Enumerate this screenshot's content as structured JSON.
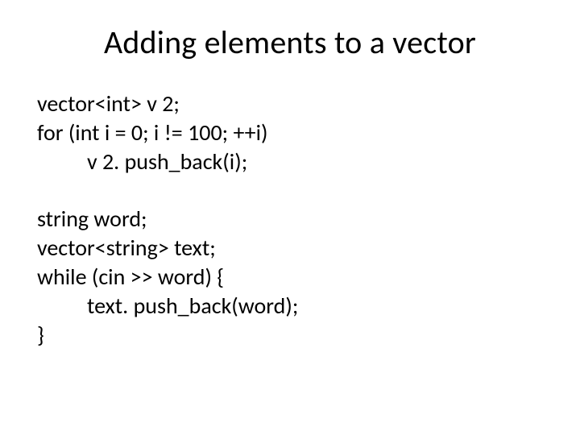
{
  "title": "Adding elements to a vector",
  "code": {
    "l1": "vector<int> v 2;",
    "l2": "for (int i = 0; i != 100; ++i)",
    "l3": "v 2. push_back(i);",
    "l4": "string word;",
    "l5": "vector<string> text;",
    "l6": "while (cin >> word) {",
    "l7": "text. push_back(word);",
    "l8": "}"
  }
}
